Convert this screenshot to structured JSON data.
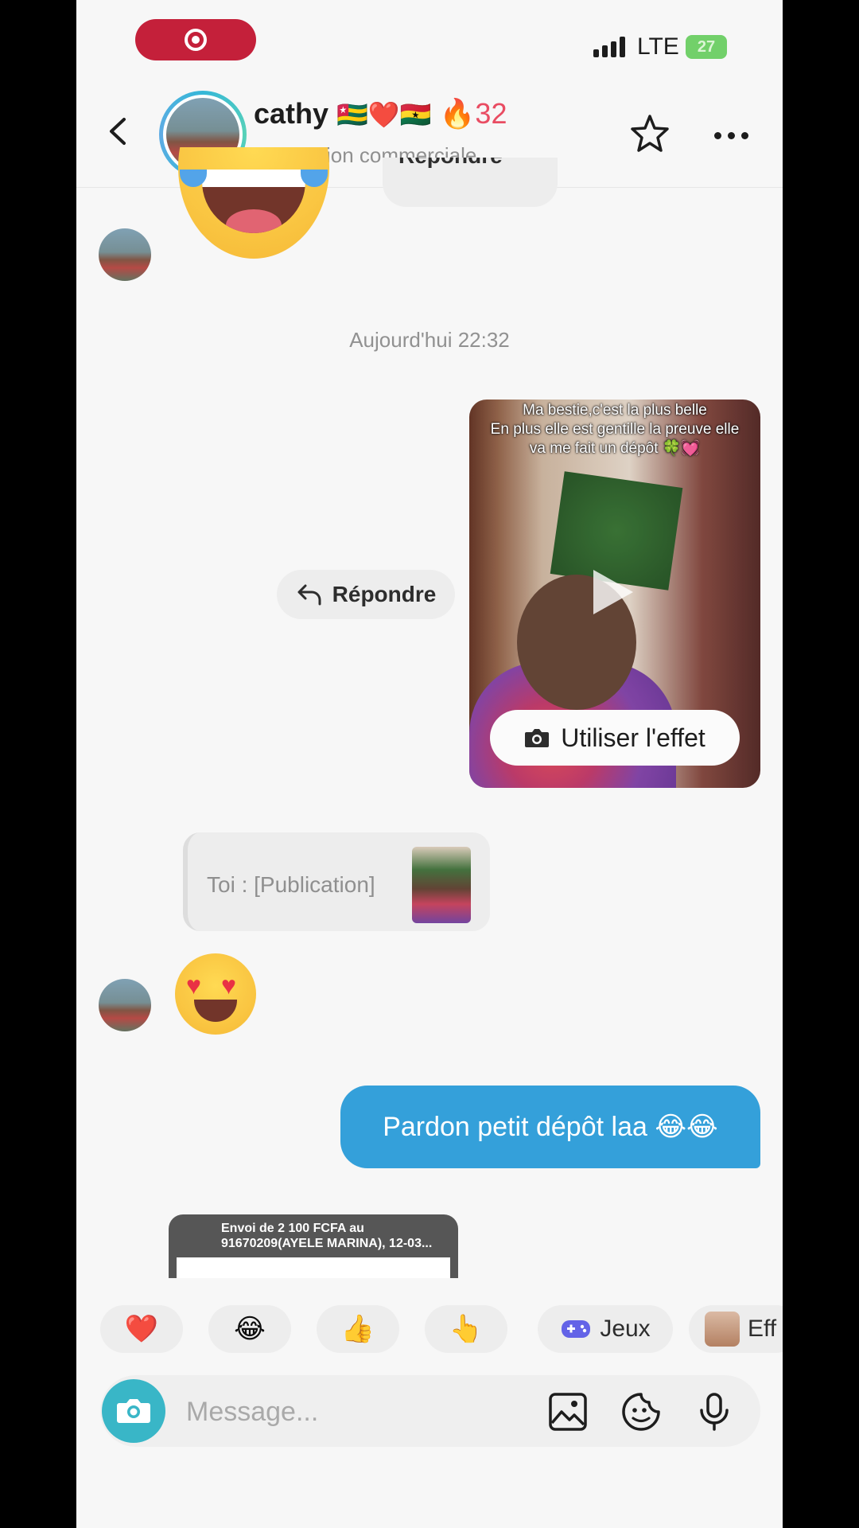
{
  "status": {
    "network": "LTE",
    "battery": "27"
  },
  "header": {
    "name": "cathy",
    "name_emojis": "🇹🇬❤️🇬🇭",
    "streak": "🔥32",
    "subtitle": "Discussion commerciale"
  },
  "thread": {
    "reply_partial": "Répondre",
    "timestamp": "Aujourd'hui 22:32",
    "video_caption_1": "Ma bestie,c'est la plus belle",
    "video_caption_2": "En plus elle est gentille la preuve elle va me fait un dépôt 🍀💓",
    "effect_button": "Utiliser l'effet",
    "reply_button": "Répondre",
    "quote_text": "Toi : [Publication]",
    "sent_message": "Pardon petit dépôt laa 😂😂",
    "receipt_text": "Envoi de 2 100 FCFA au\n91670209(AYELE MARINA), 12-03..."
  },
  "quick_reactions": {
    "heart": "❤️",
    "laugh": "😂",
    "thumbs": "👍",
    "point": "👆",
    "games_label": "Jeux",
    "effects_label": "Eff"
  },
  "composer": {
    "placeholder": "Message..."
  },
  "colors": {
    "record_pill": "#c11530",
    "sent_bubble": "#2a9bd8",
    "camera_button": "#2fb3c4",
    "streak": "#e8435a"
  },
  "icons": [
    "record-icon",
    "signal-icon",
    "battery-icon",
    "back-icon",
    "star-icon",
    "more-icon",
    "play-icon",
    "camera-icon",
    "reply-icon",
    "games-icon",
    "image-icon",
    "sticker-icon",
    "microphone-icon"
  ]
}
